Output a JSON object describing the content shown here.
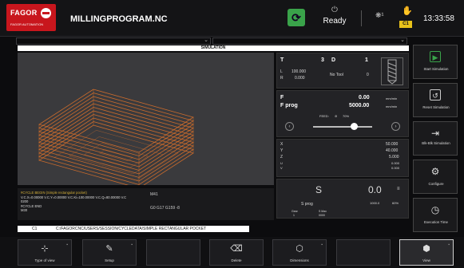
{
  "header": {
    "brand": "FAGOR",
    "brand_sub": "FAGOR AUTOMATION",
    "program_name": "MILLINGPROGRAM.NC",
    "status": "Ready",
    "status_icon": "power-icon",
    "channel_badge": "C1",
    "clock": "13:33:58",
    "accent_green": "#3aa34a",
    "brand_red": "#c8161d"
  },
  "simulation": {
    "title": "SIMULATION",
    "part_color": "#d9702a"
  },
  "bottom_info": {
    "lines": [
      "#CYCLE BEGIN (Simple rectangular pocket)",
      "V.C.X=0.00000 V.C.Y=0.00000 V.C.Ki=100.00000 V.C.Q=80.00000 V.C",
      "0200",
      "#CYCLE END",
      "M30"
    ],
    "mid_top": "M41",
    "mid_bottom": "G0 G17 G159 -8"
  },
  "path_bar": {
    "channel": "C1",
    "path": "C:/FAGORCNC/USERS/SESSION/CYCLEDATA/SIMPLE RECTANGULAR POCKET"
  },
  "tool_panel": {
    "t_label": "T",
    "t_value": "3",
    "d_label": "D",
    "d_value": "1",
    "l_label": "L",
    "l_value": "100.000",
    "r_label": "R",
    "r_value": "0.000",
    "no_tool": "No Tool",
    "tool_num": "0",
    "right_num": "1"
  },
  "feed_panel": {
    "f_label": "F",
    "f_value": "0.00",
    "f_unit": "mm/min",
    "fprog_label": "F prog",
    "fprog_value": "5000.00",
    "fprog_unit": "mm/min",
    "feed_label": "FEED:",
    "feed_pct": "70%",
    "feed_fraction": 0.7
  },
  "axis_panel": {
    "axes": [
      {
        "name": "X",
        "value": "50.000"
      },
      {
        "name": "Y",
        "value": "40.000"
      },
      {
        "name": "Z",
        "value": "5.000"
      },
      {
        "name": "U",
        "value": "0.000"
      },
      {
        "name": "V",
        "value": "0.000"
      }
    ]
  },
  "spindle_panel": {
    "s_label": "S",
    "s_value": "0.0",
    "sprog_label": "S prog",
    "sprog_value": "1000.0",
    "pct": "60%",
    "gear_label": "Gear",
    "gear_value": "1",
    "smax_label": "S Max",
    "smax_value": "0000"
  },
  "side_buttons": [
    {
      "label": "Start Simulation",
      "icon": "play-icon"
    },
    {
      "label": "Reset Simulation",
      "icon": "reset-icon"
    },
    {
      "label": "Blk-Blk Simulation",
      "icon": "block-step-icon"
    },
    {
      "label": "Configure",
      "icon": "gear-icon"
    },
    {
      "label": "Execution Time",
      "icon": "clock-icon"
    }
  ],
  "softkeys": [
    {
      "label": "Type of view",
      "icon": "axes-icon"
    },
    {
      "label": "Setup",
      "icon": "wrench-icon"
    },
    {
      "label": "Delete",
      "icon": "eraser-icon"
    },
    {
      "label": "Dimensions",
      "icon": "cube-icon"
    },
    {
      "label": "View",
      "icon": "view-cube-icon"
    }
  ]
}
